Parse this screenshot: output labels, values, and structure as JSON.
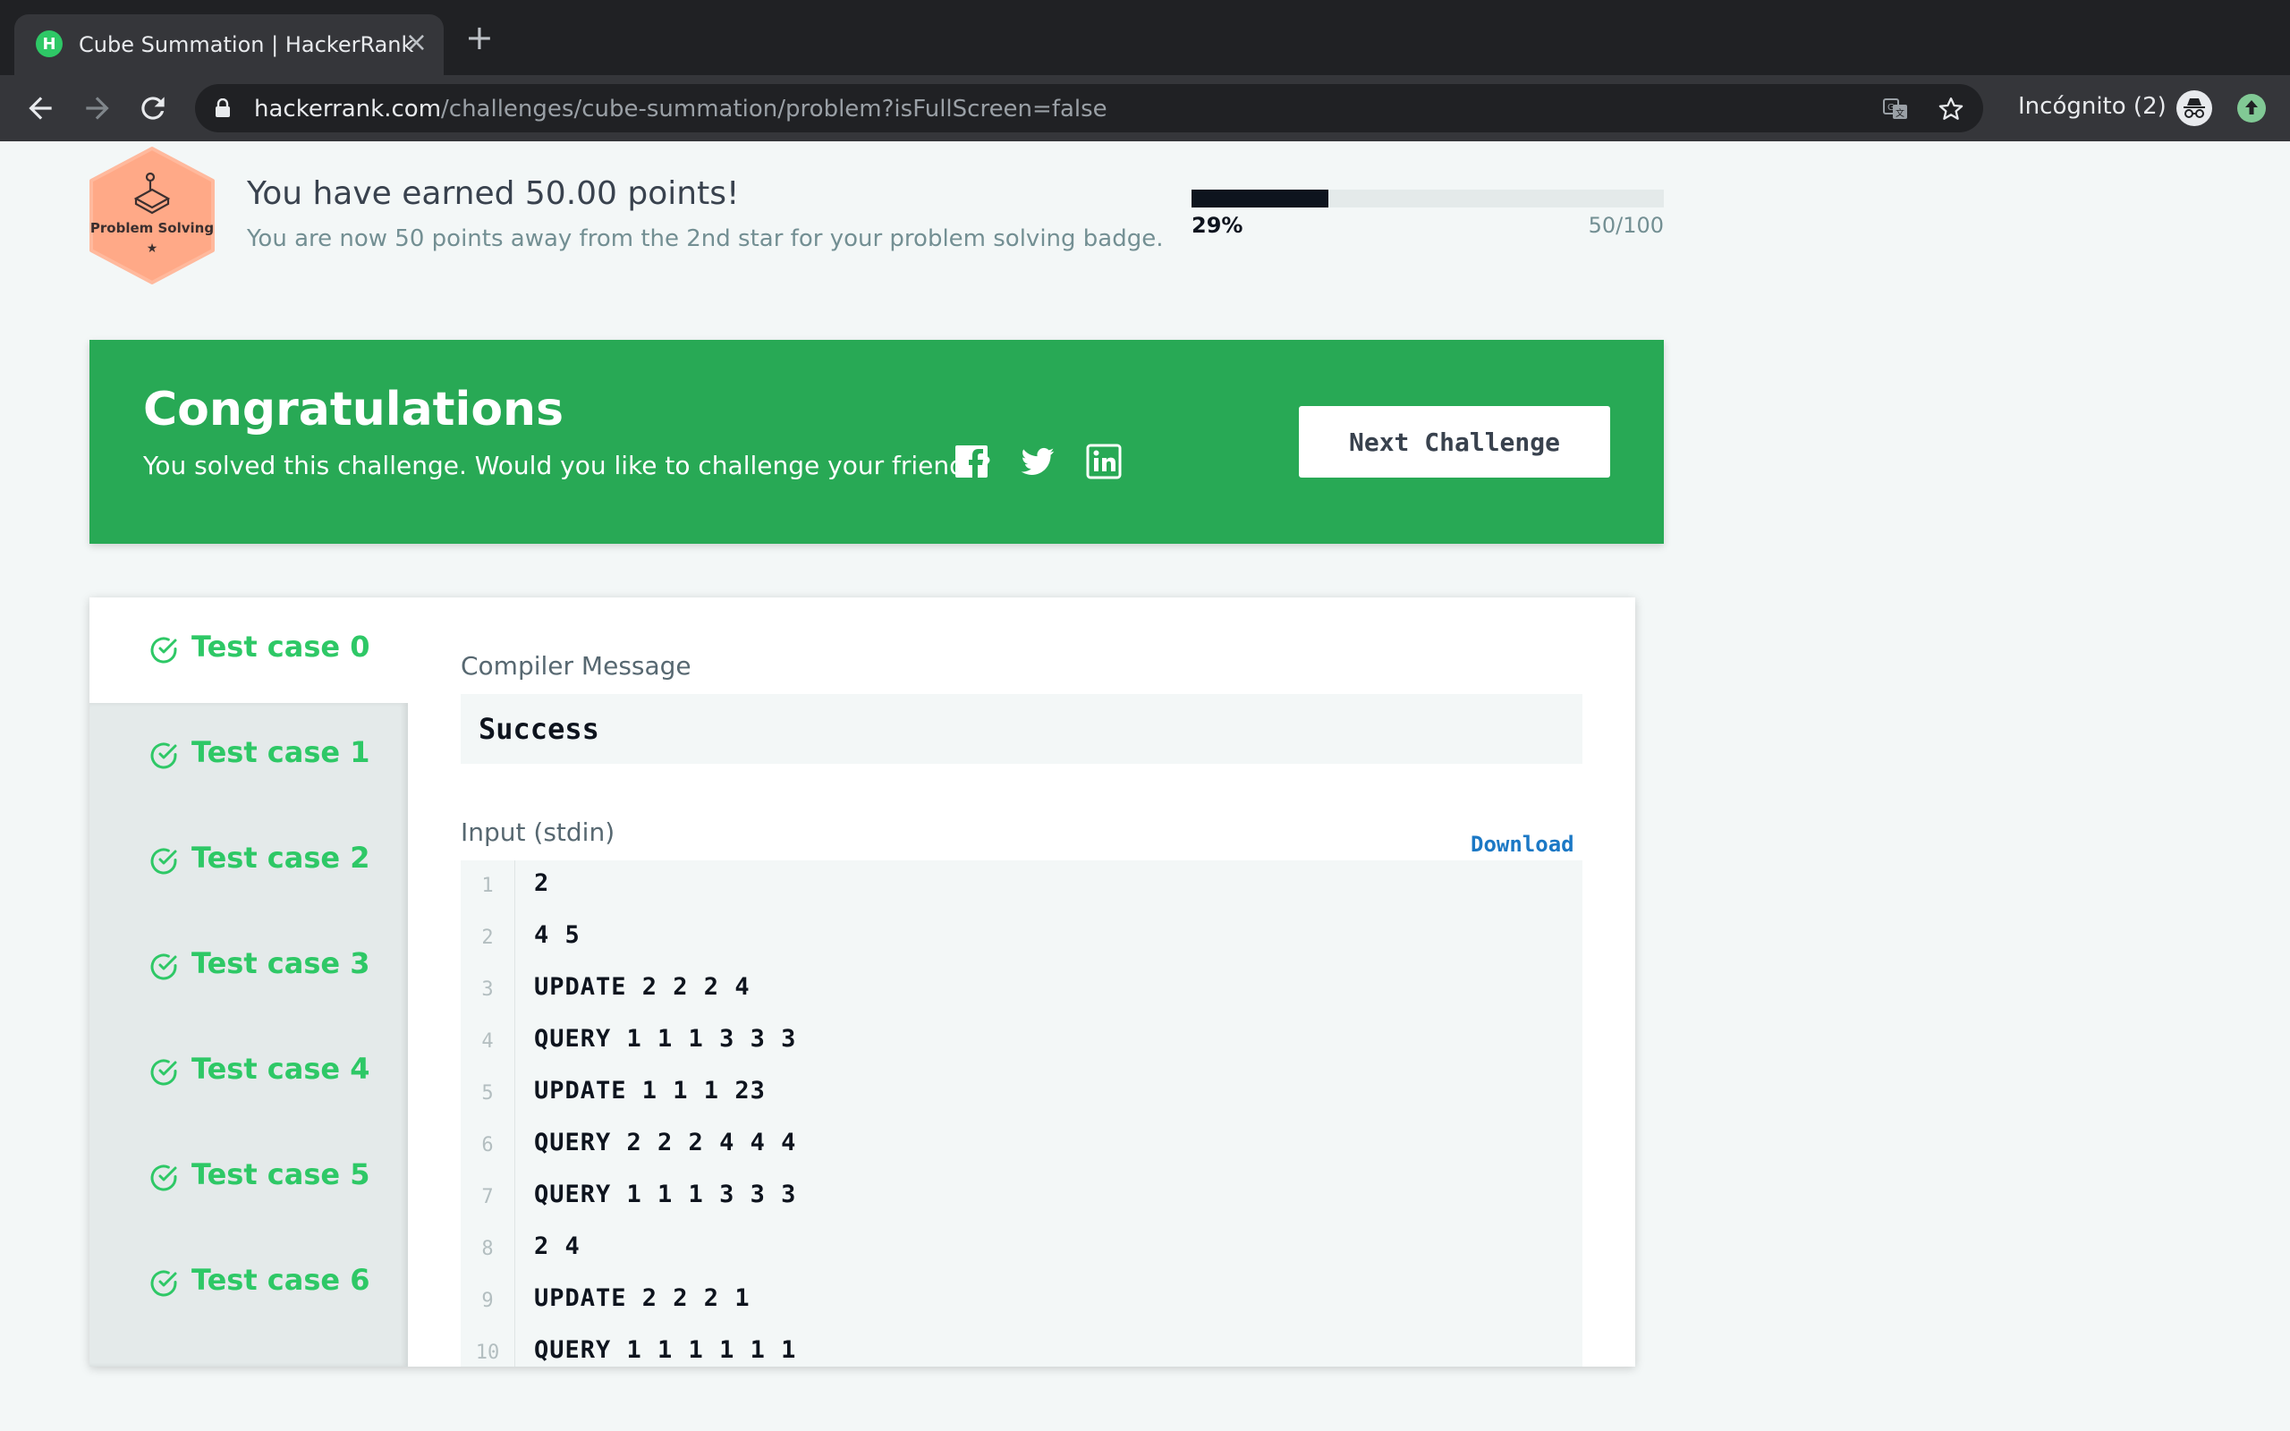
{
  "browser": {
    "tab_title": "Cube Summation | HackerRank",
    "tab_favicon_letter": "H",
    "tab_close": "×",
    "new_tab": "+",
    "url_host": "hackerrank.com",
    "url_path": "/challenges/cube-summation/problem?isFullScreen=false",
    "incognito_label": "Incógnito (2)",
    "icons": [
      "back-icon",
      "forward-icon",
      "reload-icon",
      "lock-icon",
      "translate-icon",
      "star-icon",
      "incognito-icon",
      "update-icon"
    ]
  },
  "badge": {
    "label": "Problem Solving",
    "star": "★"
  },
  "points": {
    "title": "You have earned 50.00 points!",
    "subtitle": "You are now 50 points away from the 2nd star for your problem solving badge.",
    "progress_percent_label": "29%",
    "progress_fraction": 0.29,
    "progress_count": "50/100"
  },
  "congrats": {
    "title": "Congratulations",
    "subtitle": "You solved this challenge. Would you like to challenge your friends?",
    "next_button": "Next Challenge",
    "social_icons": [
      "facebook-icon",
      "twitter-icon",
      "linkedin-icon"
    ]
  },
  "test_cases": [
    {
      "label": "Test case 0",
      "active": true
    },
    {
      "label": "Test case 1",
      "active": false
    },
    {
      "label": "Test case 2",
      "active": false
    },
    {
      "label": "Test case 3",
      "active": false
    },
    {
      "label": "Test case 4",
      "active": false
    },
    {
      "label": "Test case 5",
      "active": false
    },
    {
      "label": "Test case 6",
      "active": false
    }
  ],
  "compiler": {
    "label": "Compiler Message",
    "message": "Success"
  },
  "input": {
    "label": "Input (stdin)",
    "download": "Download",
    "lines": [
      {
        "num": "1",
        "text": "2"
      },
      {
        "num": "2",
        "text": "4 5"
      },
      {
        "num": "3",
        "text": "UPDATE 2 2 2 4"
      },
      {
        "num": "4",
        "text": "QUERY 1 1 1 3 3 3"
      },
      {
        "num": "5",
        "text": "UPDATE 1 1 1 23"
      },
      {
        "num": "6",
        "text": "QUERY 2 2 2 4 4 4"
      },
      {
        "num": "7",
        "text": "QUERY 1 1 1 3 3 3"
      },
      {
        "num": "8",
        "text": "2 4"
      },
      {
        "num": "9",
        "text": "UPDATE 2 2 2 1"
      },
      {
        "num": "10",
        "text": "QUERY 1 1 1 1 1 1"
      }
    ]
  },
  "colors": {
    "accent_green": "#2ec866",
    "banner_green": "#28a955",
    "badge_orange": "#ffa987",
    "progress_dark": "#0e141e",
    "link_blue": "#1b78c5"
  }
}
